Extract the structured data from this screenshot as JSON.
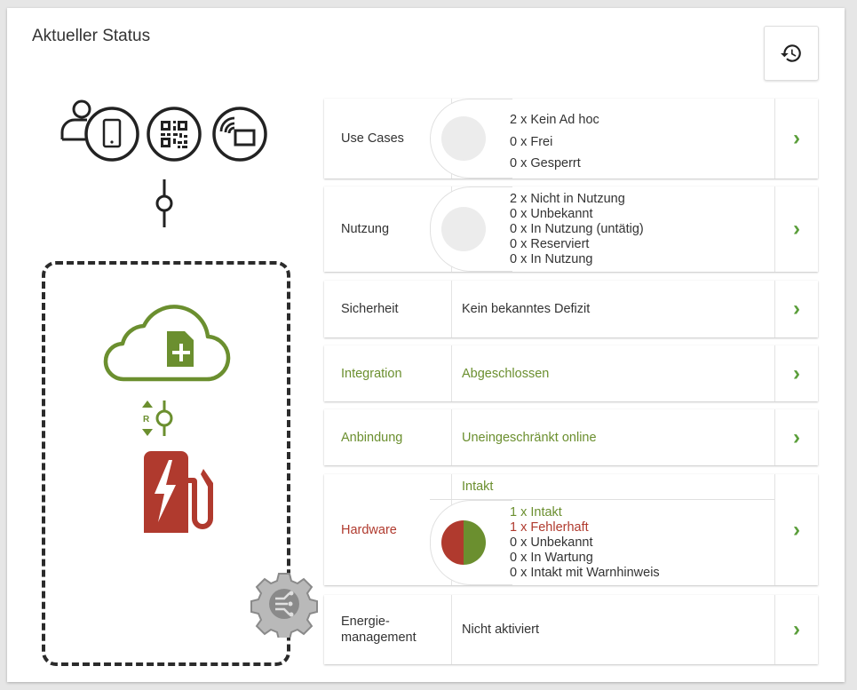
{
  "header": {
    "title": "Aktueller Status"
  },
  "diagram": {
    "hub_label": "R"
  },
  "rows": [
    {
      "label": "Use Cases",
      "lines": [
        "2 x Kein Ad hoc",
        "0 x Frei",
        "0 x Gesperrt"
      ]
    },
    {
      "label": "Nutzung",
      "lines": [
        "2 x Nicht in Nutzung",
        "0 x Unbekannt",
        "0 x In Nutzung (untätig)",
        "0 x Reserviert",
        "0 x In Nutzung"
      ]
    },
    {
      "label": "Sicherheit",
      "value": "Kein bekanntes Defizit"
    },
    {
      "label": "Integration",
      "value": "Abgeschlossen"
    },
    {
      "label": "Anbindung",
      "value": "Uneingeschränkt online"
    },
    {
      "label": "Hardware",
      "summary": "Intakt",
      "lines": [
        "1 x Intakt",
        "1 x Fehlerhaft",
        "0 x Unbekannt",
        "0 x In Wartung",
        "0 x Intakt mit Warnhinweis"
      ],
      "pie": {
        "intakt": 1,
        "fehlerhaft": 1
      }
    },
    {
      "label": "Energie-",
      "label2": "management",
      "value": "Nicht aktiviert"
    }
  ],
  "colors": {
    "green": "#6b8f2f",
    "red": "#b03a2e",
    "arrow": "#5a9e3a"
  },
  "icons": {
    "history": "history-icon",
    "arrow": "chevron-right-icon"
  }
}
